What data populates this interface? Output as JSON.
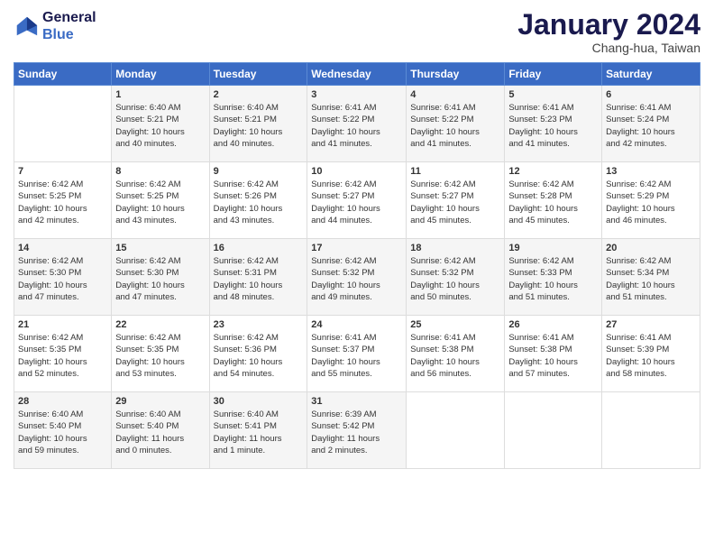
{
  "header": {
    "logo_line1": "General",
    "logo_line2": "Blue",
    "month": "January 2024",
    "location": "Chang-hua, Taiwan"
  },
  "weekdays": [
    "Sunday",
    "Monday",
    "Tuesday",
    "Wednesday",
    "Thursday",
    "Friday",
    "Saturday"
  ],
  "weeks": [
    [
      {
        "day": "",
        "info": ""
      },
      {
        "day": "1",
        "info": "Sunrise: 6:40 AM\nSunset: 5:21 PM\nDaylight: 10 hours\nand 40 minutes."
      },
      {
        "day": "2",
        "info": "Sunrise: 6:40 AM\nSunset: 5:21 PM\nDaylight: 10 hours\nand 40 minutes."
      },
      {
        "day": "3",
        "info": "Sunrise: 6:41 AM\nSunset: 5:22 PM\nDaylight: 10 hours\nand 41 minutes."
      },
      {
        "day": "4",
        "info": "Sunrise: 6:41 AM\nSunset: 5:22 PM\nDaylight: 10 hours\nand 41 minutes."
      },
      {
        "day": "5",
        "info": "Sunrise: 6:41 AM\nSunset: 5:23 PM\nDaylight: 10 hours\nand 41 minutes."
      },
      {
        "day": "6",
        "info": "Sunrise: 6:41 AM\nSunset: 5:24 PM\nDaylight: 10 hours\nand 42 minutes."
      }
    ],
    [
      {
        "day": "7",
        "info": "Sunrise: 6:42 AM\nSunset: 5:25 PM\nDaylight: 10 hours\nand 42 minutes."
      },
      {
        "day": "8",
        "info": "Sunrise: 6:42 AM\nSunset: 5:25 PM\nDaylight: 10 hours\nand 43 minutes."
      },
      {
        "day": "9",
        "info": "Sunrise: 6:42 AM\nSunset: 5:26 PM\nDaylight: 10 hours\nand 43 minutes."
      },
      {
        "day": "10",
        "info": "Sunrise: 6:42 AM\nSunset: 5:27 PM\nDaylight: 10 hours\nand 44 minutes."
      },
      {
        "day": "11",
        "info": "Sunrise: 6:42 AM\nSunset: 5:27 PM\nDaylight: 10 hours\nand 45 minutes."
      },
      {
        "day": "12",
        "info": "Sunrise: 6:42 AM\nSunset: 5:28 PM\nDaylight: 10 hours\nand 45 minutes."
      },
      {
        "day": "13",
        "info": "Sunrise: 6:42 AM\nSunset: 5:29 PM\nDaylight: 10 hours\nand 46 minutes."
      }
    ],
    [
      {
        "day": "14",
        "info": "Sunrise: 6:42 AM\nSunset: 5:30 PM\nDaylight: 10 hours\nand 47 minutes."
      },
      {
        "day": "15",
        "info": "Sunrise: 6:42 AM\nSunset: 5:30 PM\nDaylight: 10 hours\nand 47 minutes."
      },
      {
        "day": "16",
        "info": "Sunrise: 6:42 AM\nSunset: 5:31 PM\nDaylight: 10 hours\nand 48 minutes."
      },
      {
        "day": "17",
        "info": "Sunrise: 6:42 AM\nSunset: 5:32 PM\nDaylight: 10 hours\nand 49 minutes."
      },
      {
        "day": "18",
        "info": "Sunrise: 6:42 AM\nSunset: 5:32 PM\nDaylight: 10 hours\nand 50 minutes."
      },
      {
        "day": "19",
        "info": "Sunrise: 6:42 AM\nSunset: 5:33 PM\nDaylight: 10 hours\nand 51 minutes."
      },
      {
        "day": "20",
        "info": "Sunrise: 6:42 AM\nSunset: 5:34 PM\nDaylight: 10 hours\nand 51 minutes."
      }
    ],
    [
      {
        "day": "21",
        "info": "Sunrise: 6:42 AM\nSunset: 5:35 PM\nDaylight: 10 hours\nand 52 minutes."
      },
      {
        "day": "22",
        "info": "Sunrise: 6:42 AM\nSunset: 5:35 PM\nDaylight: 10 hours\nand 53 minutes."
      },
      {
        "day": "23",
        "info": "Sunrise: 6:42 AM\nSunset: 5:36 PM\nDaylight: 10 hours\nand 54 minutes."
      },
      {
        "day": "24",
        "info": "Sunrise: 6:41 AM\nSunset: 5:37 PM\nDaylight: 10 hours\nand 55 minutes."
      },
      {
        "day": "25",
        "info": "Sunrise: 6:41 AM\nSunset: 5:38 PM\nDaylight: 10 hours\nand 56 minutes."
      },
      {
        "day": "26",
        "info": "Sunrise: 6:41 AM\nSunset: 5:38 PM\nDaylight: 10 hours\nand 57 minutes."
      },
      {
        "day": "27",
        "info": "Sunrise: 6:41 AM\nSunset: 5:39 PM\nDaylight: 10 hours\nand 58 minutes."
      }
    ],
    [
      {
        "day": "28",
        "info": "Sunrise: 6:40 AM\nSunset: 5:40 PM\nDaylight: 10 hours\nand 59 minutes."
      },
      {
        "day": "29",
        "info": "Sunrise: 6:40 AM\nSunset: 5:40 PM\nDaylight: 11 hours\nand 0 minutes."
      },
      {
        "day": "30",
        "info": "Sunrise: 6:40 AM\nSunset: 5:41 PM\nDaylight: 11 hours\nand 1 minute."
      },
      {
        "day": "31",
        "info": "Sunrise: 6:39 AM\nSunset: 5:42 PM\nDaylight: 11 hours\nand 2 minutes."
      },
      {
        "day": "",
        "info": ""
      },
      {
        "day": "",
        "info": ""
      },
      {
        "day": "",
        "info": ""
      }
    ]
  ]
}
